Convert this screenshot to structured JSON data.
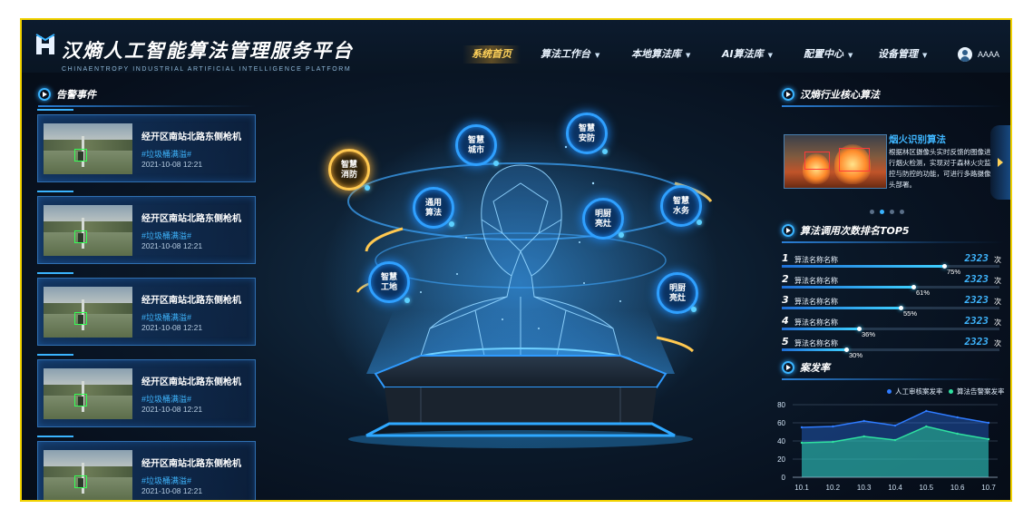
{
  "app": {
    "title": "汉熵人工智能算法管理服务平台",
    "subtitle": "CHINAENTROPY INDUSTRIAL ARTIFICIAL INTELLIGENCE PLATFORM"
  },
  "nav": {
    "items": [
      {
        "label": "系统首页",
        "active": true,
        "has_dropdown": false
      },
      {
        "label": "算法工作台",
        "active": false,
        "has_dropdown": true
      },
      {
        "label": "本地算法库",
        "active": false,
        "has_dropdown": true
      },
      {
        "label": "AI算法库",
        "active": false,
        "has_dropdown": true
      },
      {
        "label": "配置中心",
        "active": false,
        "has_dropdown": true
      },
      {
        "label": "设备管理",
        "active": false,
        "has_dropdown": true
      }
    ],
    "caret": "▼",
    "user": {
      "name": "AAAA",
      "icon": "user-avatar-icon"
    }
  },
  "alarm_panel": {
    "title": "告警事件",
    "events": [
      {
        "location": "经开区南站北路东侧枪机",
        "tag": "#垃圾桶满溢#",
        "time": "2021-10-08 12:21"
      },
      {
        "location": "经开区南站北路东侧枪机",
        "tag": "#垃圾桶满溢#",
        "time": "2021-10-08 12:21"
      },
      {
        "location": "经开区南站北路东侧枪机",
        "tag": "#垃圾桶满溢#",
        "time": "2021-10-08 12:21"
      },
      {
        "location": "经开区南站北路东侧枪机",
        "tag": "#垃圾桶满溢#",
        "time": "2021-10-08 12:21"
      },
      {
        "location": "经开区南站北路东侧枪机",
        "tag": "#垃圾桶满溢#",
        "time": "2021-10-08 12:21"
      }
    ]
  },
  "center": {
    "nodes": [
      {
        "label": "智慧消防",
        "highlight": true
      },
      {
        "label": "智慧城市",
        "highlight": false
      },
      {
        "label": "智慧安防",
        "highlight": false
      },
      {
        "label": "通用算法",
        "highlight": false
      },
      {
        "label": "明厨亮灶",
        "highlight": false
      },
      {
        "label": "智慧水务",
        "highlight": false
      },
      {
        "label": "智慧工地",
        "highlight": false
      },
      {
        "label": "明厨亮灶",
        "highlight": false
      }
    ]
  },
  "core_algorithms": {
    "title": "汉熵行业核心算法",
    "current": {
      "name": "烟火识别算法",
      "description": "根据林区摄像头实时反馈的图像进行烟火检测，实现对于森林火灾监控与防控的功能，可进行多路摄像头部署。"
    },
    "page_count": 4,
    "active_page": 2
  },
  "top5": {
    "title": "算法调用次数排名TOP5",
    "unit": "次",
    "items": [
      {
        "rank": "1",
        "name": "算法名称名称",
        "count": "2323",
        "percent": 75,
        "percent_label": "75%"
      },
      {
        "rank": "2",
        "name": "算法名称名称",
        "count": "2323",
        "percent": 61,
        "percent_label": "61%"
      },
      {
        "rank": "3",
        "name": "算法名称名称",
        "count": "2323",
        "percent": 55,
        "percent_label": "55%"
      },
      {
        "rank": "4",
        "name": "算法名称名称",
        "count": "2323",
        "percent": 36,
        "percent_label": "36%"
      },
      {
        "rank": "5",
        "name": "算法名称名称",
        "count": "2323",
        "percent": 30,
        "percent_label": "30%"
      }
    ]
  },
  "case_rate": {
    "title": "案发率",
    "colors": {
      "manual": "#2f7bff",
      "algorithm": "#2fe0a0"
    }
  },
  "chart_data": {
    "type": "area",
    "x": [
      "10.1",
      "10.2",
      "10.3",
      "10.4",
      "10.5",
      "10.6",
      "10.7"
    ],
    "series": [
      {
        "name": "人工审核案发率",
        "values": [
          55,
          56,
          62,
          57,
          73,
          66,
          60
        ]
      },
      {
        "name": "算法告警案发率",
        "values": [
          38,
          39,
          45,
          41,
          56,
          48,
          42
        ]
      }
    ],
    "yticks": [
      "0",
      "20",
      "40",
      "60",
      "80"
    ],
    "ylim": [
      0,
      80
    ],
    "grid": true,
    "legend_position": "top-right"
  }
}
